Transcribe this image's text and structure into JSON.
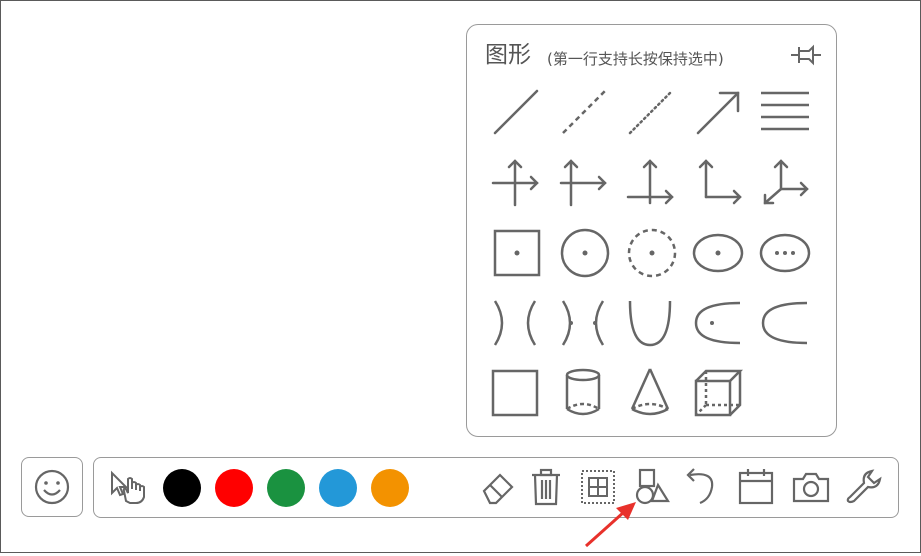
{
  "panel": {
    "title": "图形",
    "subtitle": "(第一行支持长按保持选中)",
    "pin_icon": "pushpin-icon",
    "rows": [
      [
        {
          "name": "solid-line",
          "icon": "solid-line-icon"
        },
        {
          "name": "dashed-line",
          "icon": "dashed-line-icon"
        },
        {
          "name": "dotted-line",
          "icon": "dotted-line-icon"
        },
        {
          "name": "arrow-line",
          "icon": "arrow-line-icon"
        },
        {
          "name": "parallel-lines",
          "icon": "parallel-lines-icon"
        }
      ],
      [
        {
          "name": "axes-1",
          "icon": "coordinate-axes-icon"
        },
        {
          "name": "axes-2",
          "icon": "coordinate-axes-icon"
        },
        {
          "name": "axes-3",
          "icon": "coordinate-axes-icon"
        },
        {
          "name": "axes-4",
          "icon": "coordinate-axes-icon"
        },
        {
          "name": "axes-3d",
          "icon": "3d-axes-icon"
        }
      ],
      [
        {
          "name": "square-center",
          "icon": "square-with-center-icon"
        },
        {
          "name": "circle-center",
          "icon": "circle-with-center-icon"
        },
        {
          "name": "dashed-circle-center",
          "icon": "dashed-circle-with-center-icon"
        },
        {
          "name": "ellipse-center",
          "icon": "ellipse-with-center-icon"
        },
        {
          "name": "ellipse-foci",
          "icon": "ellipse-with-foci-icon"
        }
      ],
      [
        {
          "name": "hyperbola",
          "icon": "hyperbola-icon"
        },
        {
          "name": "hyperbola-foci",
          "icon": "hyperbola-with-foci-icon"
        },
        {
          "name": "parabola-up",
          "icon": "parabola-icon"
        },
        {
          "name": "parabola-left-focus",
          "icon": "parabola-with-focus-icon"
        },
        {
          "name": "parabola-left",
          "icon": "parabola-left-icon"
        }
      ],
      [
        {
          "name": "square",
          "icon": "square-icon"
        },
        {
          "name": "cylinder",
          "icon": "cylinder-icon"
        },
        {
          "name": "cone",
          "icon": "cone-icon"
        },
        {
          "name": "cube",
          "icon": "cube-icon"
        }
      ]
    ]
  },
  "emoji": {
    "icon": "smiley-icon"
  },
  "toolbar": {
    "pointer_icon": "hand-pointer-icon",
    "colors": [
      "#000000",
      "#ff0000",
      "#1a9240",
      "#2398d8",
      "#f39200"
    ],
    "tools": [
      {
        "name": "eraser",
        "icon": "eraser-icon"
      },
      {
        "name": "trash",
        "icon": "trash-icon"
      },
      {
        "name": "select-grid",
        "icon": "selection-grid-icon"
      },
      {
        "name": "shapes",
        "icon": "shapes-icon"
      },
      {
        "name": "undo",
        "icon": "undo-icon"
      },
      {
        "name": "calendar",
        "icon": "calendar-icon"
      },
      {
        "name": "camera",
        "icon": "camera-icon"
      },
      {
        "name": "settings",
        "icon": "wrench-icon"
      }
    ]
  },
  "annotation": {
    "color": "#e8312b",
    "icon": "red-arrow-icon"
  }
}
